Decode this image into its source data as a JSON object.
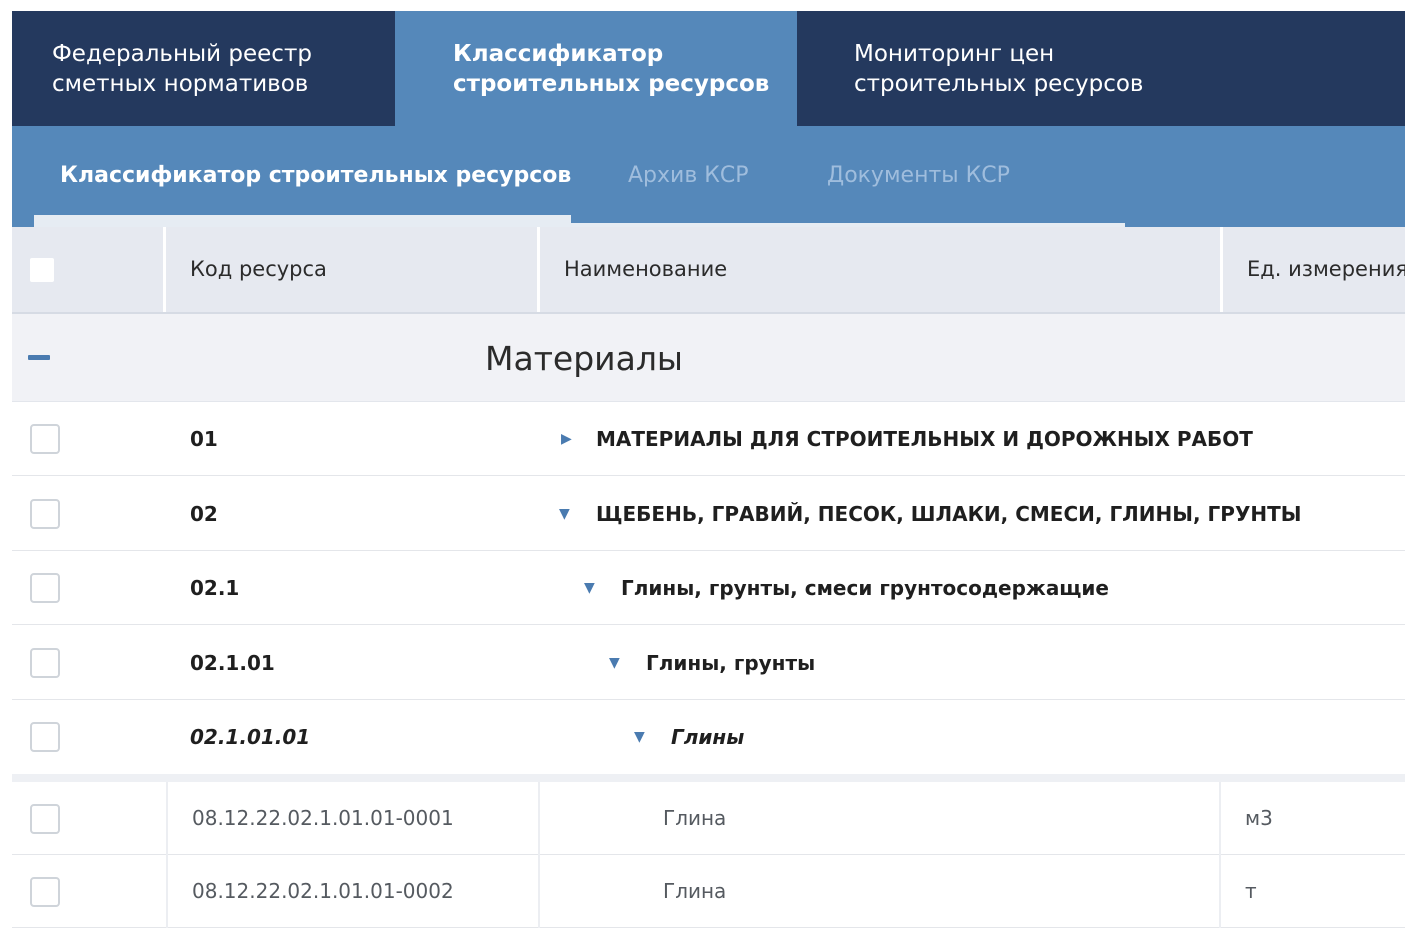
{
  "top_nav": {
    "tabs": [
      {
        "label": "Федеральный реестр\nсметных нормативов",
        "active": false
      },
      {
        "label": "Классификатор\nстроительных ресурсов",
        "active": true
      },
      {
        "label": "Мониторинг цен\nстроительных ресурсов",
        "active": false
      }
    ]
  },
  "sub_nav": {
    "tabs": [
      {
        "label": "Классификатор строительных ресурсов",
        "active": true
      },
      {
        "label": "Архив КСР",
        "active": false
      },
      {
        "label": "Документы КСР",
        "active": false
      }
    ]
  },
  "table": {
    "headers": {
      "code": "Код ресурса",
      "name": "Наименование",
      "unit": "Ед. измерения"
    },
    "group": {
      "title": "Материалы",
      "expanded": true
    },
    "category_rows": [
      {
        "code": "01",
        "name": "МАТЕРИАЛЫ ДЛЯ СТРОИТЕЛЬНЫХ И ДОРОЖНЫХ РАБОТ",
        "expanded": false
      },
      {
        "code": "02",
        "name": "ЩЕБЕНЬ, ГРАВИЙ, ПЕСОК, ШЛАКИ, СМЕСИ, ГЛИНЫ, ГРУНТЫ",
        "expanded": true
      },
      {
        "code": "02.1",
        "name": "Глины, грунты, смеси грунтосодержащие",
        "expanded": true
      },
      {
        "code": "02.1.01",
        "name": "Глины, грунты",
        "expanded": true
      },
      {
        "code": "02.1.01.01",
        "name": "Глины",
        "expanded": true
      }
    ],
    "item_rows": [
      {
        "code": "08.12.22.02.1.01.01-0001",
        "name": "Глина",
        "unit": "м3"
      },
      {
        "code": "08.12.22.02.1.01.01-0002",
        "name": "Глина",
        "unit": "т"
      }
    ]
  },
  "colors": {
    "nav_dark": "#24395e",
    "nav_blue": "#5588ba",
    "accent": "#4a7bb0",
    "header_bg": "#e6e9f0"
  }
}
